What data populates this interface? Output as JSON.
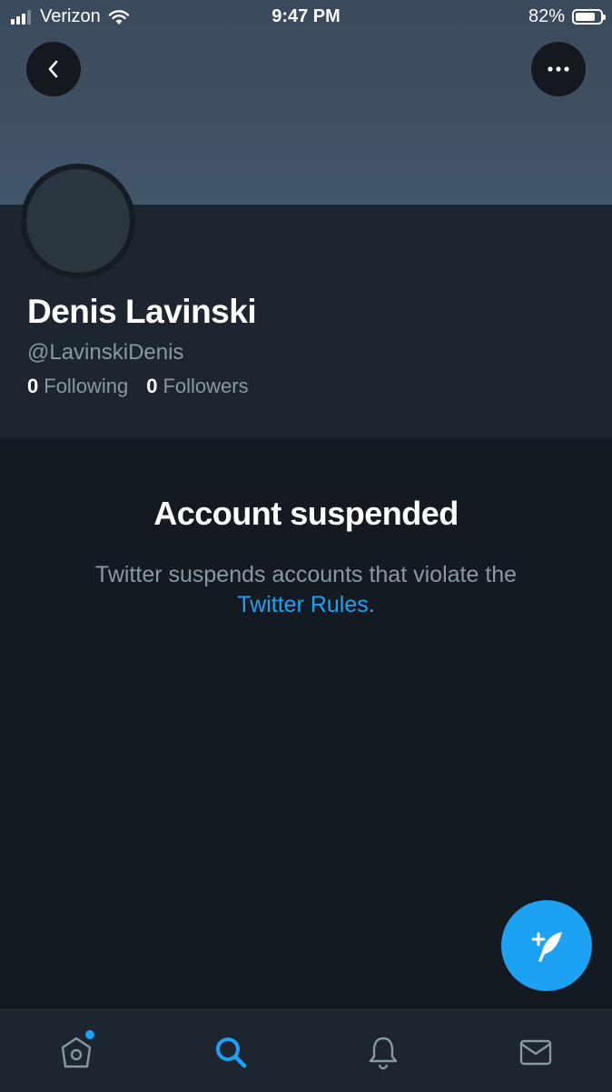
{
  "status_bar": {
    "carrier": "Verizon",
    "time": "9:47 PM",
    "battery_percent": "82%",
    "battery_level": 0.82,
    "signal_bars_active": 3,
    "signal_bars_total": 4
  },
  "header": {
    "back_icon": "chevron-left-icon",
    "more_icon": "ellipsis-icon"
  },
  "profile": {
    "display_name": "Denis Lavinski",
    "handle": "@LavinskiDenis",
    "following_count": "0",
    "following_label": "Following",
    "followers_count": "0",
    "followers_label": "Followers"
  },
  "suspension": {
    "title": "Account suspended",
    "text": "Twitter suspends accounts that violate the",
    "link": "Twitter Rules",
    "trailing": "."
  },
  "fab": {
    "icon": "compose-tweet-icon"
  },
  "tab_bar": {
    "items": [
      {
        "name": "home",
        "icon": "home-icon",
        "active": false,
        "has_dot": true
      },
      {
        "name": "search",
        "icon": "search-icon",
        "active": true
      },
      {
        "name": "notifications",
        "icon": "bell-icon",
        "active": false
      },
      {
        "name": "messages",
        "icon": "mail-icon",
        "active": false
      }
    ]
  },
  "colors": {
    "accent": "#1da1f2",
    "background": "#141a22",
    "profile_background": "#1c2530",
    "secondary_text": "#8899a6",
    "banner": "#3f5064"
  }
}
